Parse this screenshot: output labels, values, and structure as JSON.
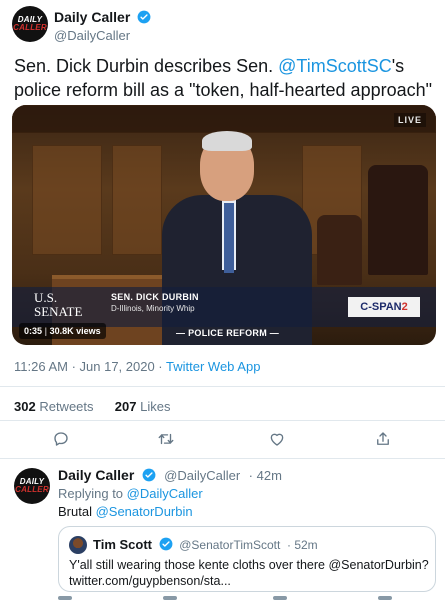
{
  "main_tweet": {
    "author": {
      "name": "Daily Caller",
      "handle": "@DailyCaller"
    },
    "avatar_logo": {
      "line1": "DAILY",
      "line2": "CALLER"
    },
    "text": {
      "part1": "Sen. Dick Durbin describes Sen. ",
      "mention": "@TimScottSC",
      "part2": "'s police reform bill as a \"token, half-hearted approach\""
    },
    "video": {
      "live_badge": "LIVE",
      "channel_banner": "U.S. SENATE",
      "speaker_name": "SEN. DICK DURBIN",
      "speaker_title": "D-Illinois, Minority Whip",
      "network_logo": {
        "main": "C-SPAN",
        "suffix": "2"
      },
      "topic": "— POLICE REFORM —",
      "duration": "0:35",
      "views": "30.8K views"
    },
    "timestamp": "11:26 AM · Jun 17, 2020 · ",
    "source_app": "Twitter Web App",
    "retweets": {
      "count": "302",
      "label": "Retweets"
    },
    "likes": {
      "count": "207",
      "label": "Likes"
    },
    "actions": [
      "reply-icon",
      "retweet-icon",
      "like-icon",
      "share-icon"
    ]
  },
  "reply_tweet": {
    "author": {
      "name": "Daily Caller",
      "handle": "@DailyCaller",
      "time": "· 42m"
    },
    "replying_to": {
      "label": "Replying to ",
      "target": "@DailyCaller"
    },
    "text": {
      "part1": "Brutal ",
      "mention": "@SenatorDurbin"
    },
    "quote": {
      "author": {
        "name": "Tim Scott",
        "handle": "@SenatorTimScott",
        "time": "· 52m"
      },
      "text": "Y'all still wearing those kente cloths over there @SenatorDurbin? twitter.com/guypbenson/sta..."
    }
  },
  "colors": {
    "link": "#1b95e0",
    "verified": "#1da1f2",
    "secondary_text": "#657786",
    "divider": "#e1e8ed"
  }
}
